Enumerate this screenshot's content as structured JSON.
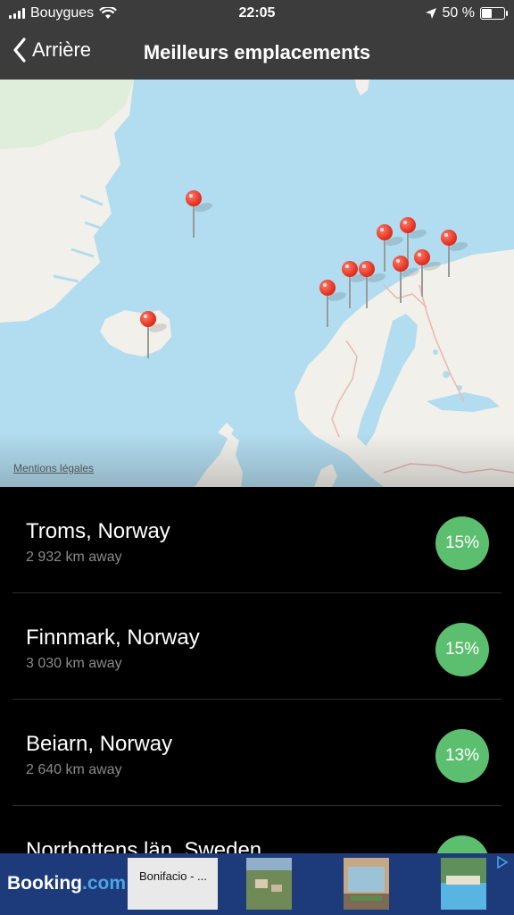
{
  "status_bar": {
    "carrier": "Bouygues",
    "time": "22:05",
    "battery_text": "50 %",
    "battery_level": 0.5,
    "icons": [
      "signal-icon",
      "wifi-icon",
      "location-arrow-icon",
      "battery-icon"
    ]
  },
  "nav": {
    "back_label": "Arrière",
    "title": "Meilleurs emplacements"
  },
  "map": {
    "legal_label": "Mentions légales",
    "pin_count": 10,
    "colors": {
      "water": "#b2dcef",
      "land": "#f2f0ea",
      "greenland": "#e3eedc",
      "pin": "#e53423"
    }
  },
  "locations": [
    {
      "name": "Troms, Norway",
      "distance": "2 932 km away",
      "score": "15%"
    },
    {
      "name": "Finnmark, Norway",
      "distance": "3 030 km away",
      "score": "15%"
    },
    {
      "name": "Beiarn, Norway",
      "distance": "2 640 km away",
      "score": "13%"
    },
    {
      "name": "Norrbottens län, Sweden",
      "distance": "",
      "score": ""
    }
  ],
  "ad": {
    "brand_main": "Booking",
    "brand_suffix": ".com",
    "card_text": "Bonifacio - ...",
    "colors": {
      "background": "#1d3b7a",
      "accent": "#4aa6e8"
    }
  },
  "colors": {
    "bar": "#3c3c3c",
    "badge": "#5cbf6f",
    "list_bg": "#000000"
  }
}
